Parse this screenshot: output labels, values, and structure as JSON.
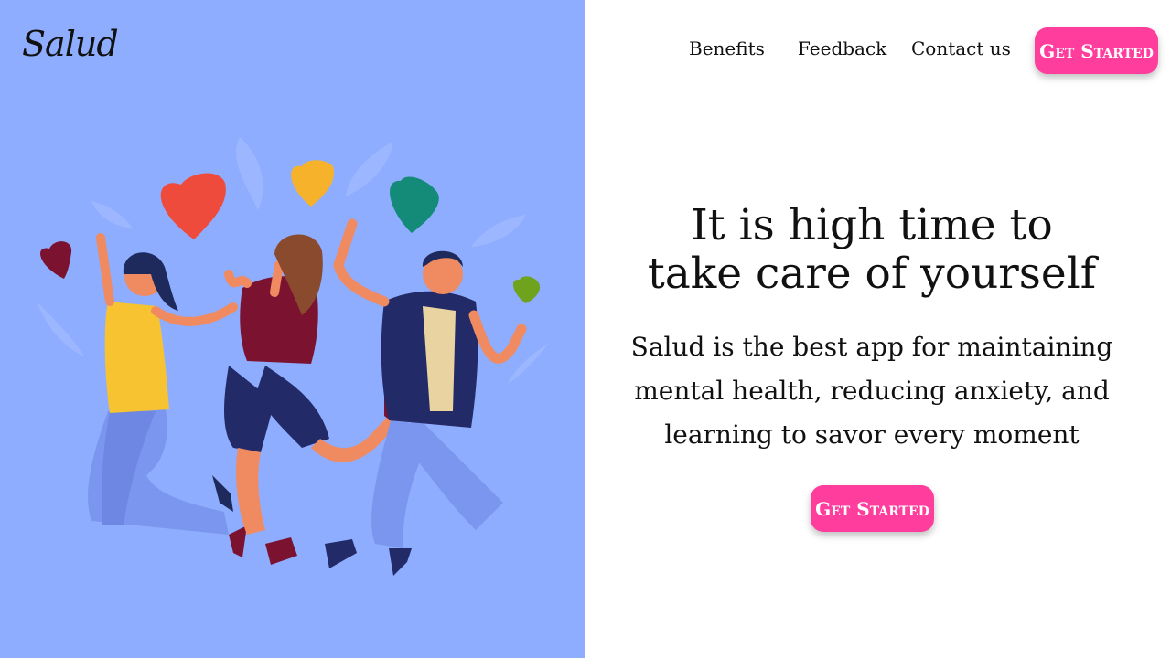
{
  "brand": {
    "logo_text": "Salud"
  },
  "nav": {
    "links": [
      {
        "label": "Benefits"
      },
      {
        "label": "Feedback"
      },
      {
        "label": "Contact us"
      }
    ],
    "cta_label": "Get Started"
  },
  "hero": {
    "headline_line1": "It is high time to",
    "headline_line2": "take care of yourself",
    "description": "Salud is the best app for maintaining mental health, reducing anxiety, and learning to savor every moment",
    "cta_label": "Get Started"
  },
  "colors": {
    "left_panel_bg": "#8eadff",
    "accent": "#ff3d9d",
    "text": "#111111"
  },
  "icons": [
    "heart-icon",
    "people-jumping-illustration"
  ]
}
